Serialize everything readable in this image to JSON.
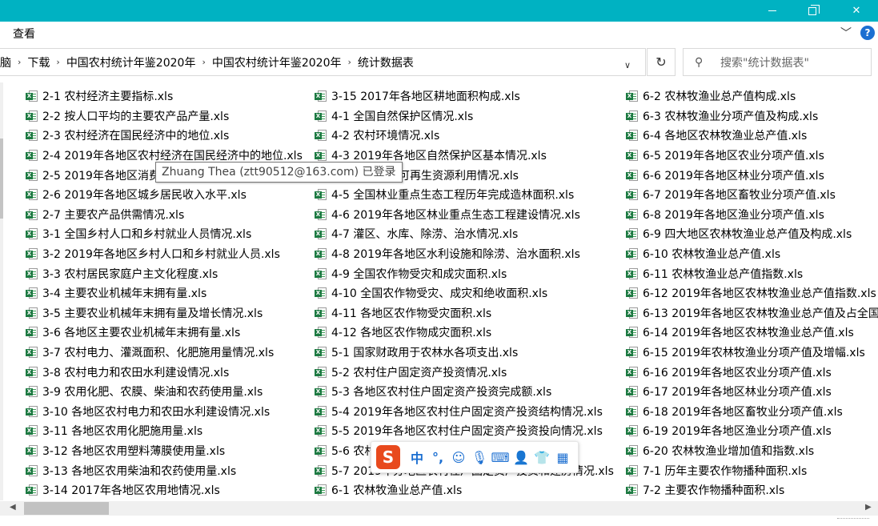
{
  "ribbon": {
    "view_label": "查看",
    "help_label": "?"
  },
  "address": {
    "crumbs": [
      "脑",
      "下载",
      "中国农村统计年鉴2020年",
      "中国农村统计年鉴2020年",
      "统计数据表"
    ]
  },
  "search": {
    "placeholder": "搜索\"统计数据表\""
  },
  "tooltip": {
    "text": "Zhuang Thea (ztt90512@163.com) 已登录"
  },
  "ime": {
    "lang_label": "中",
    "punct_label": "°,"
  },
  "files": {
    "col1": [
      "2-1 农村经济主要指标.xls",
      "2-2 按人口平均的主要农产品产量.xls",
      "2-3 农村经济在国民经济中的地位.xls",
      "2-4 2019年各地区农村经济在国民经济中的地位.xls",
      "2-5 2019年各地区消费",
      "2-6 2019年各地区城乡居民收入水平.xls",
      "2-7 主要农产品供需情况.xls",
      "3-1 全国乡村人口和乡村就业人员情况.xls",
      "3-2 2019年各地区乡村人口和乡村就业人员.xls",
      "3-3 农村居民家庭户主文化程度.xls",
      "3-4 主要农业机械年末拥有量.xls",
      "3-5 主要农业机械年末拥有量及增长情况.xls",
      "3-6 各地区主要农业机械年末拥有量.xls",
      "3-7 农村电力、灌溉面积、化肥施用量情况.xls",
      "3-8 农村电力和农田水利建设情况.xls",
      "3-9 农用化肥、农膜、柴油和农药使用量.xls",
      "3-10 各地区农村电力和农田水利建设情况.xls",
      "3-11 各地区农用化肥施用量.xls",
      "3-12 各地区农用塑料薄膜使用量.xls",
      "3-13 各地区农用柴油和农药使用量.xls",
      "3-14 2017年各地区农用地情况.xls"
    ],
    "col2": [
      "3-15 2017年各地区耕地面积构成.xls",
      "4-1 全国自然保护区情况.xls",
      "4-2 农村环境情况.xls",
      "4-3 2019年各地区自然保护区基本情况.xls",
      "年各地区农村可再生资源利用情况.xls",
      "4-5 全国林业重点生态工程历年完成造林面积.xls",
      "4-6 2019年各地区林业重点生态工程建设情况.xls",
      "4-7 灌区、水库、除涝、治水情况.xls",
      "4-8 2019年各地区水利设施和除涝、治水面积.xls",
      "4-9 全国农作物受灾和成灾面积.xls",
      "4-10 全国农作物受灾、成灾和绝收面积.xls",
      "4-11 各地区农作物受灾面积.xls",
      "4-12 各地区农作物成灾面积.xls",
      "5-1 国家财政用于农林水各项支出.xls",
      "5-2 农村住户固定资产投资情况.xls",
      "5-3 各地区农村住户固定资产投资完成额.xls",
      "5-4 2019年各地区农村住户固定资产投资结构情况.xls",
      "5-5 2019年各地区农村住户固定资产投资投向情况.xls",
      "5-6 农村",
      "5-7 2019年分地区农村住户固定资产投资和建房情况.xls",
      "6-1 农林牧渔业总产值.xls"
    ],
    "col3": [
      "6-2 农林牧渔业总产值构成.xls",
      "6-3 农林牧渔业分项产值及构成.xls",
      "6-4 各地区农林牧渔业总产值.xls",
      "6-5 2019年各地区农业分项产值.xls",
      "6-6 2019年各地区林业分项产值.xls",
      "6-7 2019年各地区畜牧业分项产值.xls",
      "6-8 2019年各地区渔业分项产值.xls",
      "6-9 四大地区农林牧渔业总产值及构成.xls",
      "6-10 农林牧渔业总产值.xls",
      "6-11 农林牧渔业总产值指数.xls",
      "6-12 2019年各地区农林牧渔业总产值指数.xls",
      "6-13 2019年各地区农林牧渔业总产值及占全国比",
      "6-14 2019年各地区农林牧渔业总产值.xls",
      "6-15 2019年农林牧渔业分项产值及增幅.xls",
      "6-16 2019年各地区农业分项产值.xls",
      "6-17 2019年各地区林业分项产值.xls",
      "6-18 2019年各地区畜牧业分项产值.xls",
      "6-19 2019年各地区渔业分项产值.xls",
      "6-20 农林牧渔业增加值和指数.xls",
      "7-1 历年主要农作物播种面积.xls",
      "7-2 主要农作物播种面积.xls"
    ]
  }
}
